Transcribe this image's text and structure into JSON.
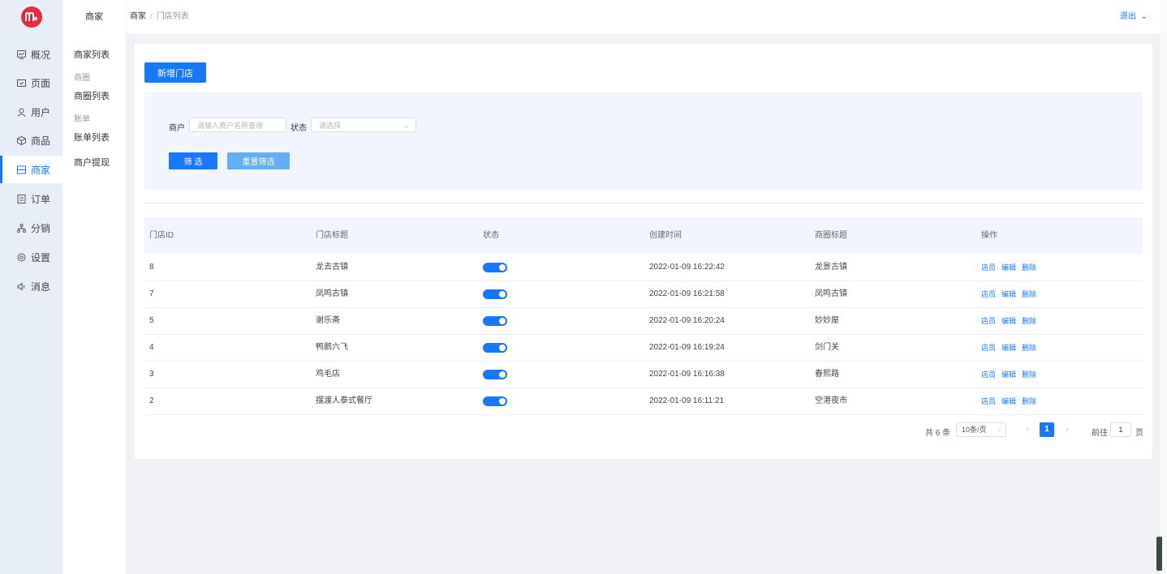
{
  "rail": {
    "items": [
      {
        "label": "概况",
        "icon": "dashboard-icon"
      },
      {
        "label": "页面",
        "icon": "page-icon"
      },
      {
        "label": "用户",
        "icon": "user-icon"
      },
      {
        "label": "商品",
        "icon": "goods-icon"
      },
      {
        "label": "商家",
        "icon": "store-icon"
      },
      {
        "label": "订单",
        "icon": "order-icon"
      },
      {
        "label": "分销",
        "icon": "share-icon"
      },
      {
        "label": "设置",
        "icon": "settings-icon"
      },
      {
        "label": "消息",
        "icon": "message-icon"
      }
    ],
    "active": "商家",
    "accent": "#1677ff",
    "logo_color": "#e8293b"
  },
  "subnav": {
    "title": "商家",
    "merchant_list": "商家列表",
    "group_business": "商圈",
    "business_list": "商圈列表",
    "group_bill": "账单",
    "bill_list": "账单列表",
    "withdraw": "商户提现"
  },
  "header": {
    "breadcrumb_root": "商家",
    "breadcrumb_sep": "/",
    "breadcrumb_current": "门店列表",
    "logout": "退出"
  },
  "toolbar": {
    "add_store": "新增门店"
  },
  "filter": {
    "merchant_label": "商户",
    "merchant_placeholder": "请输入商户名称查询",
    "status_label": "状态",
    "status_placeholder": "请选择",
    "filter_button": "筛 选",
    "reset_button": "重置筛选"
  },
  "table": {
    "headers": [
      "门店ID",
      "门店标题",
      "状态",
      "创建时间",
      "商圈标题",
      "操作"
    ],
    "ops": [
      "店员",
      "编辑",
      "删除"
    ],
    "rows": [
      {
        "id": "8",
        "title": "龙去古镇",
        "enabled": true,
        "created": "2022-01-09 16:22:42",
        "circle": "龙景古镇"
      },
      {
        "id": "7",
        "title": "凤鸣古镇",
        "enabled": true,
        "created": "2022-01-09 16:21:58",
        "circle": "凤鸣古镇"
      },
      {
        "id": "5",
        "title": "谢乐斋",
        "enabled": true,
        "created": "2022-01-09 16:20:24",
        "circle": "妙妙屋"
      },
      {
        "id": "4",
        "title": "鸭鹅六飞",
        "enabled": true,
        "created": "2022-01-09 16:19:24",
        "circle": "剑门关"
      },
      {
        "id": "3",
        "title": "鸡毛店",
        "enabled": true,
        "created": "2022-01-09 16:16:38",
        "circle": "春熙路"
      },
      {
        "id": "2",
        "title": "摆渡人泰式餐厅",
        "enabled": true,
        "created": "2022-01-09 16:11:21",
        "circle": "空港夜市"
      }
    ]
  },
  "pagination": {
    "total": "共 6 条",
    "page_size": "10条/页",
    "current": "1",
    "goto_label": "前往",
    "goto_value": "1",
    "page_suffix": "页"
  }
}
